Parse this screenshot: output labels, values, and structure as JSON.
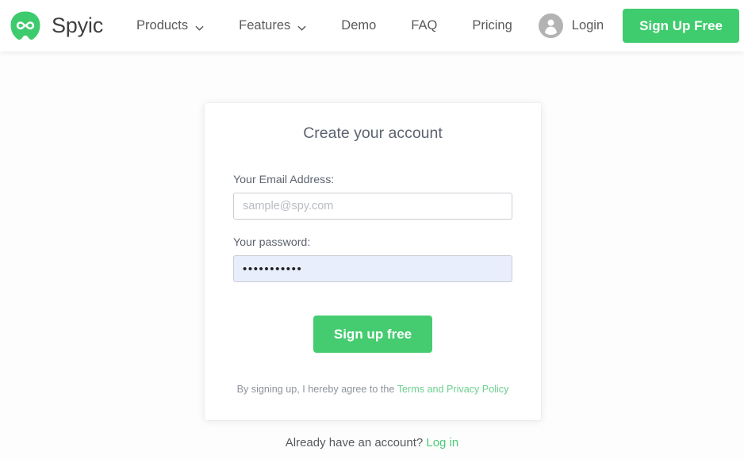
{
  "header": {
    "brand": {
      "name": "Spyic",
      "logo_icon": "infinity-logo-icon",
      "logo_color": "#3ecb6e"
    },
    "nav": [
      {
        "label": "Products",
        "has_dropdown": true,
        "icon": "chevron-down-icon"
      },
      {
        "label": "Features",
        "has_dropdown": true,
        "icon": "chevron-down-icon"
      },
      {
        "label": "Demo",
        "has_dropdown": false
      },
      {
        "label": "FAQ",
        "has_dropdown": false
      },
      {
        "label": "Pricing",
        "has_dropdown": false
      }
    ],
    "login": {
      "label": "Login",
      "icon": "user-avatar-icon",
      "icon_color": "#b3b3b3"
    },
    "signup_button": {
      "label": "Sign Up Free",
      "background": "#3fcc6e",
      "text_color": "#ffffff"
    }
  },
  "card": {
    "title": "Create your account",
    "email_field": {
      "label": "Your Email Address:",
      "placeholder": "sample@spy.com",
      "value": ""
    },
    "password_field": {
      "label": "Your password:",
      "value": "•••••••••••",
      "masked_char_count": 11,
      "autofill_background": "#e8eefb"
    },
    "submit_button": {
      "label": "Sign up free",
      "background": "#45cc70",
      "text_color": "#ffffff"
    },
    "terms": {
      "prefix": "By signing up, I hereby agree to the ",
      "link_label": "Terms and Privacy Policy",
      "link_color": "#6ccf8f"
    }
  },
  "footer": {
    "prompt": "Already have an account? ",
    "login_link": "Log in",
    "link_color": "#49cb77"
  }
}
